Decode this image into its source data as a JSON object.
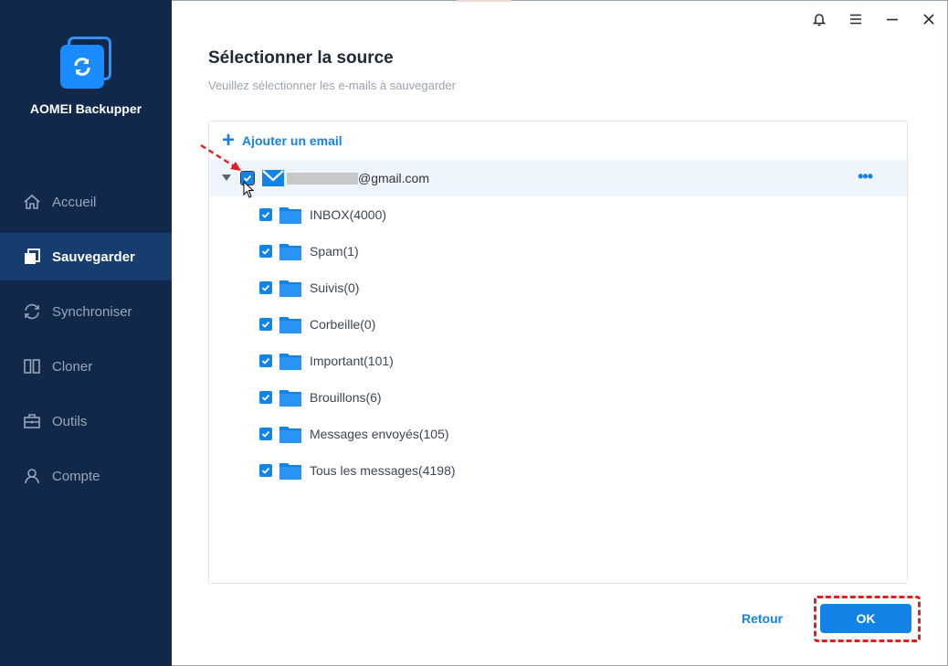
{
  "app": {
    "name": "AOMEI Backupper"
  },
  "colors": {
    "sidebar_bg": "#11284a",
    "sidebar_active": "#173d70",
    "accent": "#1483e8",
    "highlight_red": "#e02020"
  },
  "window_controls": [
    {
      "icon": "bell-icon"
    },
    {
      "icon": "menu-icon"
    },
    {
      "icon": "minimize-icon"
    },
    {
      "icon": "close-icon"
    }
  ],
  "sidebar": {
    "items": [
      {
        "label": "Accueil",
        "icon": "home-icon",
        "active": false
      },
      {
        "label": "Sauvegarder",
        "icon": "backup-icon",
        "active": true
      },
      {
        "label": "Synchroniser",
        "icon": "sync-icon",
        "active": false
      },
      {
        "label": "Cloner",
        "icon": "clone-icon",
        "active": false
      },
      {
        "label": "Outils",
        "icon": "tools-icon",
        "active": false
      },
      {
        "label": "Compte",
        "icon": "account-icon",
        "active": false
      }
    ]
  },
  "main": {
    "title": "Sélectionner la source",
    "subtitle": "Veuillez sélectionner les e-mails à sauvegarder",
    "add_email_label": "Ajouter un email",
    "account": {
      "email_suffix": "@gmail.com",
      "checked": true,
      "more_label": "•••"
    },
    "folders": [
      {
        "label": "INBOX(4000)",
        "checked": true
      },
      {
        "label": "Spam(1)",
        "checked": true
      },
      {
        "label": "Suivis(0)",
        "checked": true
      },
      {
        "label": "Corbeille(0)",
        "checked": true
      },
      {
        "label": "Important(101)",
        "checked": true
      },
      {
        "label": "Brouillons(6)",
        "checked": true
      },
      {
        "label": "Messages envoyés(105)",
        "checked": true
      },
      {
        "label": "Tous les messages(4198)",
        "checked": true
      }
    ]
  },
  "footer": {
    "back_label": "Retour",
    "ok_label": "OK"
  }
}
